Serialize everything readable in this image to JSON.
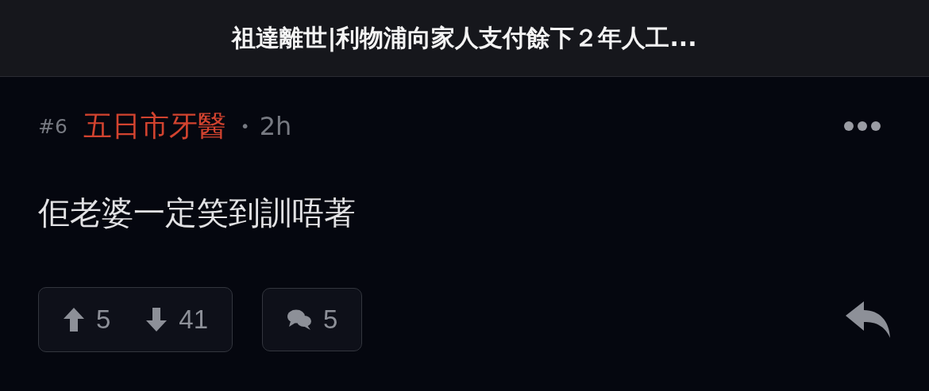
{
  "header": {
    "title": "祖達離世|利物浦向家人支付餘下２年人工..."
  },
  "post": {
    "number": "#6",
    "author": "五日市牙醫",
    "separator": "•",
    "time": "2h",
    "content": "佢老婆一定笑到訓唔著",
    "upvotes": "5",
    "downvotes": "41",
    "replies": "5"
  }
}
